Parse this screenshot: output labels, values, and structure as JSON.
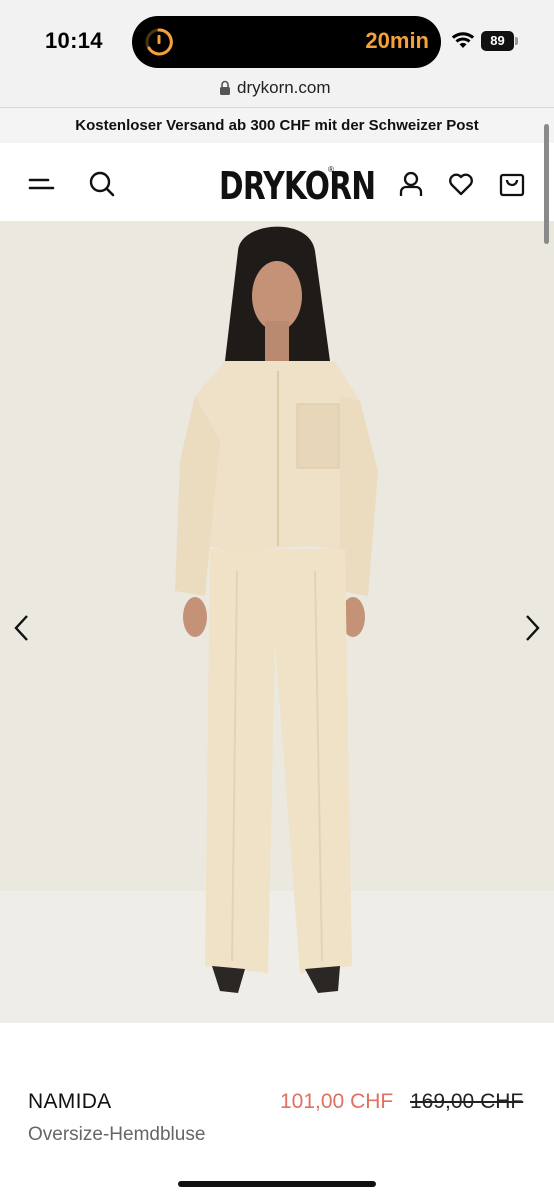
{
  "status_bar": {
    "time": "10:14",
    "timer": "20min",
    "battery_percent": "89",
    "battery_level": 0.89
  },
  "browser": {
    "url": "drykorn.com"
  },
  "promo": {
    "text": "Kostenloser Versand ab 300 CHF mit der Schweizer Post"
  },
  "header": {
    "logo": "DRYKORN",
    "logo_mark": "®",
    "icons": [
      "menu-icon",
      "search-icon",
      "account-icon",
      "wishlist-icon",
      "cart-icon"
    ]
  },
  "gallery": {
    "image_alt": "Model in beige oversize shirt blouse and wide trousers",
    "prev_icon": "chevron-left-icon",
    "next_icon": "chevron-right-icon"
  },
  "product": {
    "name": "NAMIDA",
    "subtitle": "Oversize-Hemdbluse",
    "price_sale": "101,00 CHF",
    "price_original": "169,00 CHF"
  },
  "colors": {
    "sale": "#e0705f",
    "timer": "#f5a03a",
    "background_image": "#ece9e1",
    "garment": "#eee1c7"
  }
}
